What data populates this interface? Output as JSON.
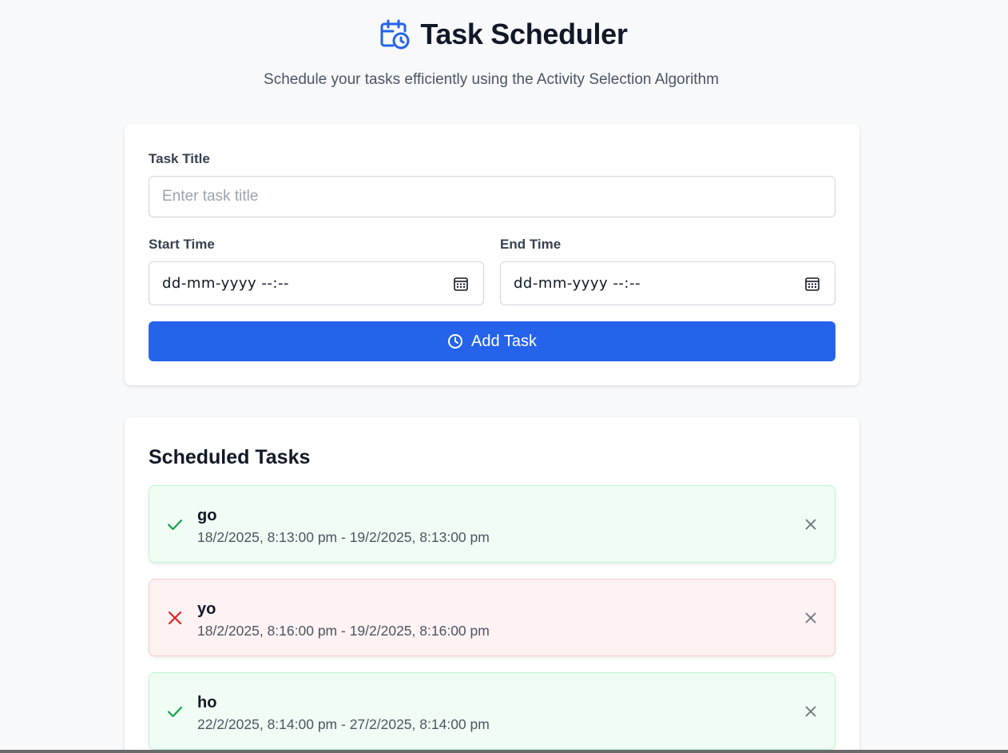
{
  "header": {
    "title": "Task Scheduler",
    "subtitle": "Schedule your tasks efficiently using the Activity Selection Algorithm",
    "icon": "calendar-clock-icon"
  },
  "form": {
    "title_label": "Task Title",
    "title_placeholder": "Enter task title",
    "title_value": "",
    "start_label": "Start Time",
    "start_value": "dd-mm-yyyy --:--",
    "end_label": "End Time",
    "end_value": "dd-mm-yyyy --:--",
    "add_button": "Add Task"
  },
  "list": {
    "title": "Scheduled Tasks",
    "tasks": [
      {
        "name": "go",
        "time": "18/2/2025, 8:13:00 pm - 19/2/2025, 8:13:00 pm",
        "status": "selected"
      },
      {
        "name": "yo",
        "time": "18/2/2025, 8:16:00 pm - 19/2/2025, 8:16:00 pm",
        "status": "rejected"
      },
      {
        "name": "ho",
        "time": "22/2/2025, 8:14:00 pm - 27/2/2025, 8:14:00 pm",
        "status": "selected"
      }
    ]
  },
  "colors": {
    "accent": "#2563eb",
    "success": "#16a34a",
    "danger": "#dc2626"
  }
}
